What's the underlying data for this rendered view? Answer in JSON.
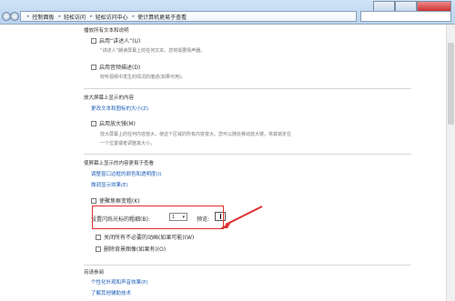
{
  "breadcrumb": [
    {
      "label": "控制面板"
    },
    {
      "label": "轻松访问"
    },
    {
      "label": "轻松访问中心"
    },
    {
      "label": "使计算机更易于查看"
    }
  ],
  "sections": {
    "narrator_head": "播放所有文本和说明",
    "narrator_checkbox": "启用“讲述人”(U)",
    "narrator_desc": "“讲述人”朗读屏幕上的任何文本。您将需要扬声器。",
    "audio_desc_checkbox": "启用音频描述(D)",
    "audio_desc_desc": "收听视频中发生的情况的描述(如果可用)。",
    "magnify_head": "放大屏幕上显示的内容",
    "magnify_link": "更改文本和图标的大小(Z)",
    "magnifier_checkbox": "启用放大镜(M)",
    "magnifier_desc_1": "放大屏幕上的任何内容放大，使这个区域的所有内容变大。您可以随处移动放大镜，将其锁定在",
    "magnifier_desc_2": "一个位置或者调整其大小。",
    "easier_head": "使屏幕上显示的内容更易于查看",
    "link_colors": "调整窗口边框的颜色和透明度(I)",
    "link_display": "微调显示效果(E)",
    "focus_rect_checkbox": "使聚焦框变粗(K)",
    "cursor_thickness_label": "设置闪烁光标的粗细(B):",
    "cursor_value": "1",
    "preview_label": "预览:",
    "disable_animations_checkbox": "关闭所有不必要的动画(如果可能)(W)",
    "remove_bg_checkbox": "删除背景图像(如果有)(O)",
    "see_also_head": "另请参阅",
    "see_also_1": "个性化外观和声音效果(P)",
    "see_also_2": "了解其他辅助技术"
  },
  "colors": {
    "highlight": "#e03030",
    "link": "#1c5fb8"
  },
  "icons": {
    "back": "back-arrow-icon",
    "forward": "forward-arrow-icon",
    "separator": "chevron-right-icon"
  }
}
